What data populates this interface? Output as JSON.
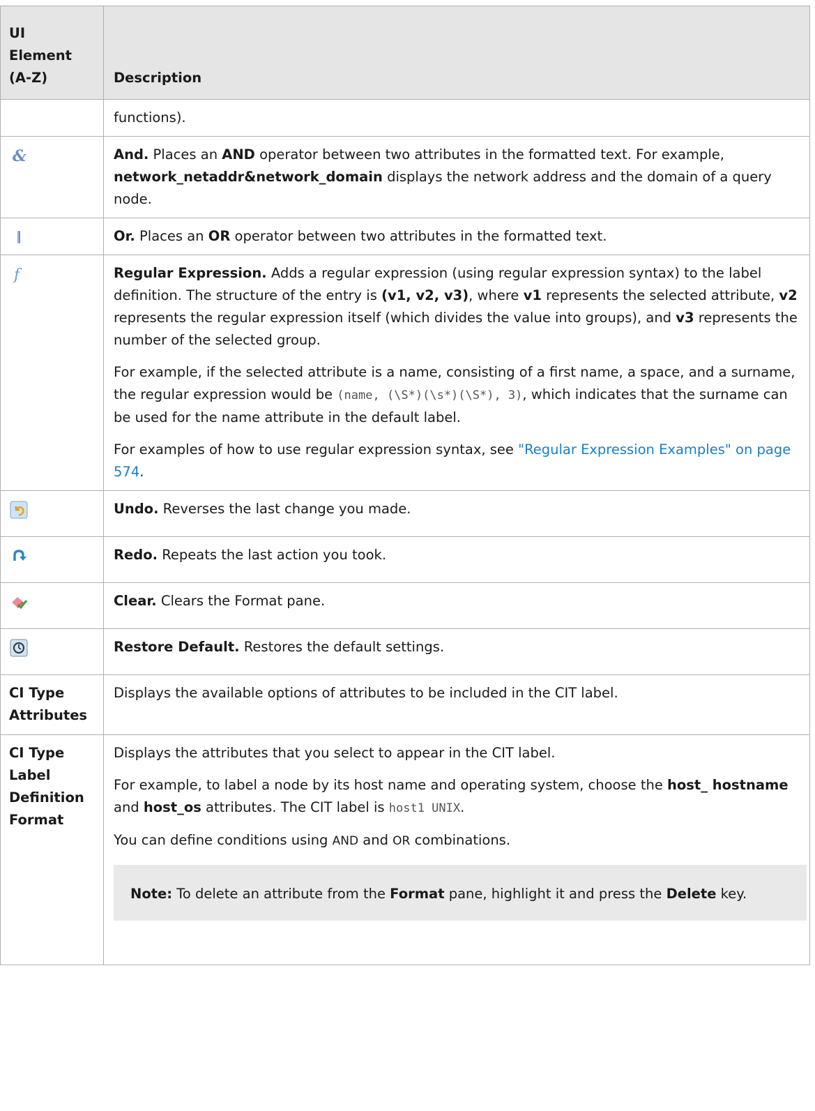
{
  "header": {
    "col1_lines": [
      "UI",
      "Element",
      "(A-Z)"
    ],
    "col2": "Description"
  },
  "rows": {
    "cont": {
      "text": "functions)."
    },
    "and": {
      "icon": "ampersand-icon",
      "b1": "And.",
      "t1": " Places an ",
      "b2": "AND",
      "t2": " operator between two attributes in the formatted text. For example, ",
      "b3": "network_netaddr&network_domain",
      "t3": " displays the network address and the domain of a query node."
    },
    "or": {
      "icon": "pipe-icon",
      "b1": "Or.",
      "t1": " Places an ",
      "b2": "OR",
      "t2": " operator between two attributes in the formatted text."
    },
    "regex": {
      "icon": "function-icon",
      "b1": "Regular Expression.",
      "t1": " Adds a regular expression (using regular expression syntax) to the label definition. The structure of the entry is ",
      "b2": "(v1, v2, v3)",
      "t2": ", where ",
      "b3": "v1",
      "t3": " represents the selected attribute, ",
      "b4": "v2",
      "t4": " represents the regular expression itself (which divides the value into groups), and ",
      "b5": "v3",
      "t5": " represents the number of the selected group.",
      "p2_t1": "For example, if the selected attribute is a name, consisting of a first name, a space, and a surname, the regular expression would be ",
      "p2_code": "(name, (\\S*)(\\s*)(\\S*), 3)",
      "p2_t2": ", which indicates that the surname can be used for the name attribute in the default label.",
      "p3_t1": "For examples of how to use regular expression syntax, see ",
      "p3_link": "\"Regular Expression Examples\" on page 574",
      "p3_t2": "."
    },
    "undo": {
      "icon": "undo-icon",
      "b1": "Undo.",
      "t1": " Reverses the last change you made."
    },
    "redo": {
      "icon": "redo-icon",
      "b1": "Redo.",
      "t1": " Repeats the last action you took."
    },
    "clear": {
      "icon": "eraser-icon",
      "b1": "Clear.",
      "t1": " Clears the Format pane."
    },
    "restore": {
      "icon": "restore-icon",
      "b1": "Restore Default.",
      "t1": " Restores the default settings."
    },
    "attrs": {
      "el_lines": [
        "CI Type",
        "Attributes"
      ],
      "text": "Displays the available options of attributes to be included in the CIT label."
    },
    "format": {
      "el_lines": [
        "CI Type",
        "Label",
        "Definition",
        "Format"
      ],
      "p1": "Displays the attributes that you select to appear in the CIT label.",
      "p2_t1": "For example, to label a node by its host name and operating system, choose the ",
      "p2_b1": "host_ hostname",
      "p2_t2": " and ",
      "p2_b2": "host_os",
      "p2_t3": " attributes. The CIT label is ",
      "p2_code": "host1 UNIX",
      "p2_t4": ".",
      "p3_t1": "You can define conditions using ",
      "p3_c1": "AND",
      "p3_t2": " and ",
      "p3_c2": "OR",
      "p3_t3": " combinations.",
      "note_b1": "Note:",
      "note_t1": " To delete an attribute from the ",
      "note_b2": "Format",
      "note_t2": " pane, highlight it and press the ",
      "note_b3": "Delete",
      "note_t3": " key."
    }
  },
  "colors": {
    "header_bg": "#e5e5e5",
    "link": "#1b7fc4",
    "note_bg": "#e9e9e9",
    "border": "#b0b0b0"
  }
}
